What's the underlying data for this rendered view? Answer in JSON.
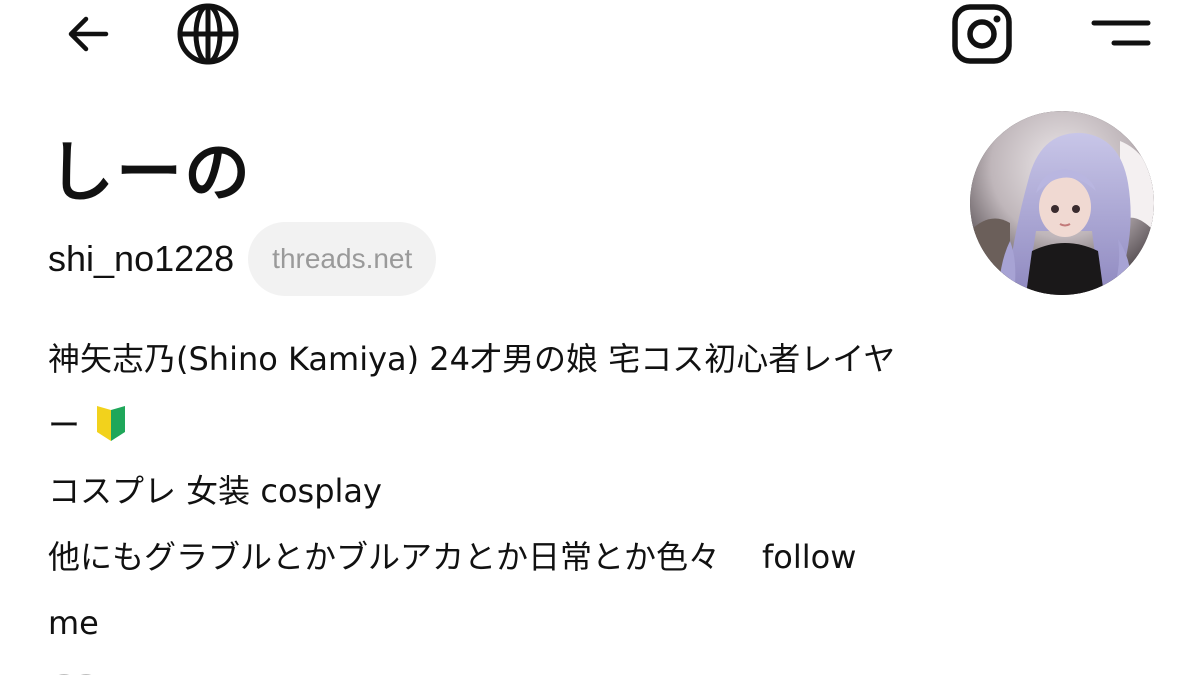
{
  "profile": {
    "display_name": "しーの",
    "username": "shi_no1228",
    "domain_badge": "threads.net",
    "avatar_alt": "profile photo"
  },
  "bio": {
    "line1": "神矢志乃(Shino Kamiya) 24才男の娘 宅コス初心者レイヤ",
    "line2": "ー",
    "line2_emoji": "beginner-mark-emoji",
    "line3": "コスプレ 女装 cosplay",
    "line4a": "他にもグラブルとかブルアカとか日常とか色々",
    "line4b": "follow",
    "line5": "me"
  },
  "icons": {
    "back": "back-arrow-icon",
    "globe": "globe-icon",
    "instagram": "instagram-icon",
    "menu": "menu-icon"
  },
  "colors": {
    "text": "#111111",
    "badge_text": "#9a9a9a",
    "badge_bg": "#f2f2f2",
    "beginner_yellow": "#f2d21c",
    "beginner_green": "#1fa75a"
  }
}
